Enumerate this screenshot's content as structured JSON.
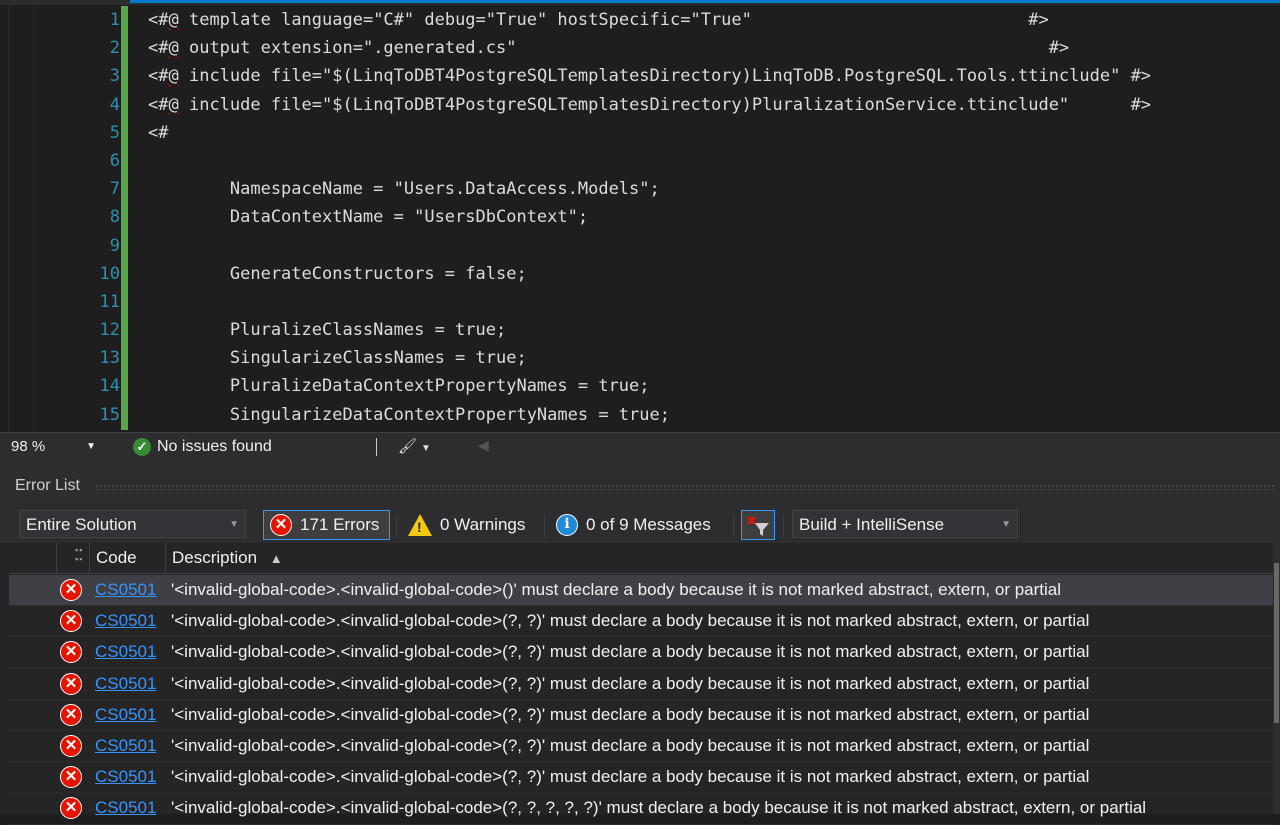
{
  "editor": {
    "line_numbers": [
      "1",
      "2",
      "3",
      "4",
      "5",
      "6",
      "7",
      "8",
      "9",
      "10",
      "11",
      "12",
      "13",
      "14",
      "15"
    ],
    "lines": [
      {
        "directive": true,
        "text": " template language=\"C#\" debug=\"True\" hostSpecific=\"True\"                           #>"
      },
      {
        "directive": true,
        "text": " output extension=\".generated.cs\"                                                    #>"
      },
      {
        "directive": true,
        "text": " include file=\"$(LinqToDBT4PostgreSQLTemplatesDirectory)LinqToDB.PostgreSQL.Tools.ttinclude\" #>"
      },
      {
        "directive": true,
        "text": " include file=\"$(LinqToDBT4PostgreSQLTemplatesDirectory)PluralizationService.ttinclude\"      #>"
      },
      {
        "directive": false,
        "text": "<#"
      },
      {
        "directive": false,
        "text": ""
      },
      {
        "directive": false,
        "text": "        NamespaceName = \"Users.DataAccess.Models\";"
      },
      {
        "directive": false,
        "text": "        DataContextName = \"UsersDbContext\";"
      },
      {
        "directive": false,
        "text": ""
      },
      {
        "directive": false,
        "text": "        GenerateConstructors = false;"
      },
      {
        "directive": false,
        "text": ""
      },
      {
        "directive": false,
        "text": "        PluralizeClassNames = true;"
      },
      {
        "directive": false,
        "text": "        SingularizeClassNames = true;"
      },
      {
        "directive": false,
        "text": "        PluralizeDataContextPropertyNames = true;"
      },
      {
        "directive": false,
        "text": "        SingularizeDataContextPropertyNames = true;"
      }
    ],
    "directive_prefix": "<#",
    "directive_at": "@"
  },
  "status": {
    "zoom": "98 %",
    "issues": "No issues found"
  },
  "error_list": {
    "title": "Error List",
    "scope": "Entire Solution",
    "errors_label": "171 Errors",
    "warnings_label": "0 Warnings",
    "messages_label": "0 of 9 Messages",
    "source": "Build + IntelliSense",
    "columns": {
      "code": "Code",
      "description": "Description"
    },
    "rows": [
      {
        "code": "CS0501",
        "description": "'<invalid-global-code>.<invalid-global-code>()' must declare a body because it is not marked abstract, extern, or partial"
      },
      {
        "code": "CS0501",
        "description": "'<invalid-global-code>.<invalid-global-code>(?, ?)' must declare a body because it is not marked abstract, extern, or partial"
      },
      {
        "code": "CS0501",
        "description": "'<invalid-global-code>.<invalid-global-code>(?, ?)' must declare a body because it is not marked abstract, extern, or partial"
      },
      {
        "code": "CS0501",
        "description": "'<invalid-global-code>.<invalid-global-code>(?, ?)' must declare a body because it is not marked abstract, extern, or partial"
      },
      {
        "code": "CS0501",
        "description": "'<invalid-global-code>.<invalid-global-code>(?, ?)' must declare a body because it is not marked abstract, extern, or partial"
      },
      {
        "code": "CS0501",
        "description": "'<invalid-global-code>.<invalid-global-code>(?, ?)' must declare a body because it is not marked abstract, extern, or partial"
      },
      {
        "code": "CS0501",
        "description": "'<invalid-global-code>.<invalid-global-code>(?, ?)' must declare a body because it is not marked abstract, extern, or partial"
      },
      {
        "code": "CS0501",
        "description": "'<invalid-global-code>.<invalid-global-code>(?, ?, ?, ?, ?)' must declare a body because it is not marked abstract, extern, or partial"
      }
    ]
  },
  "colors": {
    "editor_bg": "#1e1e1e",
    "line_number": "#2b91af",
    "change_bar": "#57a64a",
    "accent": "#3399ff",
    "error": "#e51400",
    "link": "#3794ff"
  },
  "icons": {
    "issues": "check-circle-icon",
    "brush": "brush-icon",
    "error": "error-circle-icon",
    "warning": "warning-triangle-icon",
    "info": "info-circle-icon",
    "filter": "clear-filter-icon",
    "sort": "sort-ascending-icon"
  }
}
